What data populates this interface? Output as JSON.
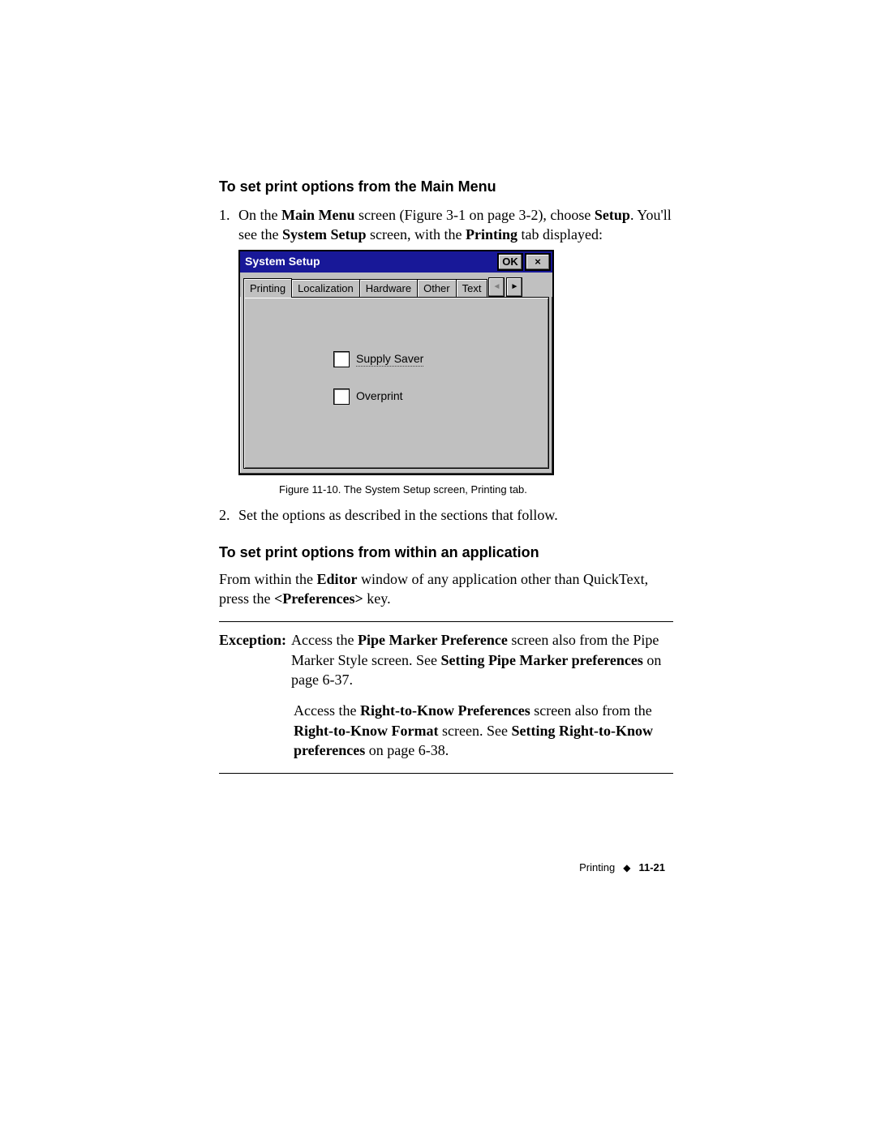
{
  "heading1": "To set print options from the Main Menu",
  "step1": {
    "num": "1.",
    "pre": "On the ",
    "b1": "Main Menu",
    "mid1": " screen (Figure 3-1 on page 3-2), choose ",
    "b2": "Setup",
    "after": ". You'll see the ",
    "b3": "System Setup",
    "mid2": " screen, with the ",
    "b4": "Printing",
    "tail": " tab displayed:"
  },
  "window": {
    "title": "System Setup",
    "ok": "OK",
    "close": "×",
    "tabs": [
      "Printing",
      "Localization",
      "Hardware",
      "Other",
      "Text"
    ],
    "scroll_left": "◄",
    "scroll_right": "►",
    "checkbox1": "Supply Saver",
    "checkbox2": "Overprint"
  },
  "caption": "Figure 11-10. The System Setup screen, Printing tab.",
  "step2": {
    "num": "2.",
    "text": "Set the options as described in the sections that follow."
  },
  "heading2": "To set print options from within an application",
  "para2": {
    "pre": "From within the ",
    "b1": "Editor",
    "mid": " window of any application other than QuickText, press the ",
    "b2": "<Preferences>",
    "tail": " key."
  },
  "exception": {
    "label": "Exception:",
    "p1_pre": "Access the ",
    "p1_b1": "Pipe Marker Preference",
    "p1_mid": " screen also from the Pipe Marker Style screen. See ",
    "p1_b2": "Setting Pipe Marker preferences",
    "p1_tail": " on page 6-37.",
    "p2_pre": "Access the ",
    "p2_b1": "Right-to-Know Preferences",
    "p2_mid": " screen also from the ",
    "p2_b2": "Right-to-Know Format",
    "p2_mid2": " screen. See ",
    "p2_b3": "Setting Right-to-Know preferences",
    "p2_tail": " on page 6-38."
  },
  "footer": {
    "section": "Printing",
    "diamond": "◆",
    "page": "11-21"
  }
}
